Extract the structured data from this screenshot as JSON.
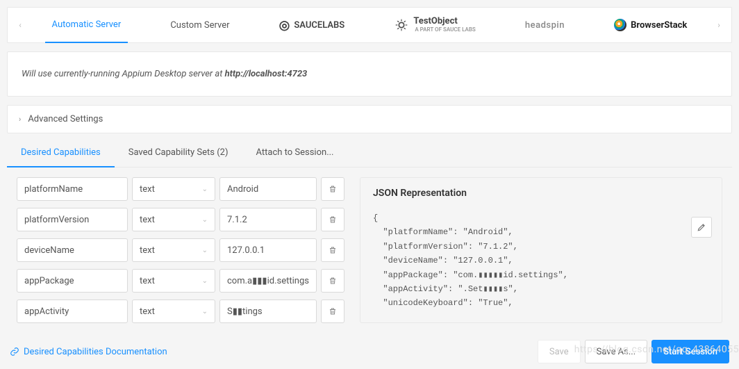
{
  "serverTabs": {
    "automatic": "Automatic Server",
    "custom": "Custom Server",
    "saucelabs": "SAUCELABS",
    "testobject": "TestObject",
    "testobject_sub": "A PART OF SAUCE LABS",
    "headspin": "headspin",
    "browserstack": "BrowserStack"
  },
  "serverInfo": {
    "prefix": "Will use currently-running Appium Desktop server at ",
    "url": "http://localhost:4723"
  },
  "advanced": {
    "label": "Advanced Settings"
  },
  "subTabs": {
    "desired": "Desired Capabilities",
    "saved": "Saved Capability Sets (2)",
    "attach": "Attach to Session..."
  },
  "caps": [
    {
      "name": "platformName",
      "type": "text",
      "value": "Android"
    },
    {
      "name": "platformVersion",
      "type": "text",
      "value": "7.1.2"
    },
    {
      "name": "deviceName",
      "type": "text",
      "value": "127.0.0.1"
    },
    {
      "name": "appPackage",
      "type": "text",
      "value": "com.a▮▮▮id.settings"
    },
    {
      "name": "appActivity",
      "type": "text",
      "value": "S▮▮tings"
    }
  ],
  "json": {
    "title": "JSON Representation",
    "body": "{\n  \"platformName\": \"Android\",\n  \"platformVersion\": \"7.1.2\",\n  \"deviceName\": \"127.0.0.1\",\n  \"appPackage\": \"com.▮▮▮▮▮id.settings\",\n  \"appActivity\": \".Set▮▮▮▮s\",\n  \"unicodeKeyboard\": \"True\","
  },
  "docLink": "Desired Capabilities Documentation",
  "buttons": {
    "save": "Save",
    "saveAs": "Save As...",
    "start": "Start Session"
  },
  "watermark": "https://blog.csdn.net/qq_43864055"
}
